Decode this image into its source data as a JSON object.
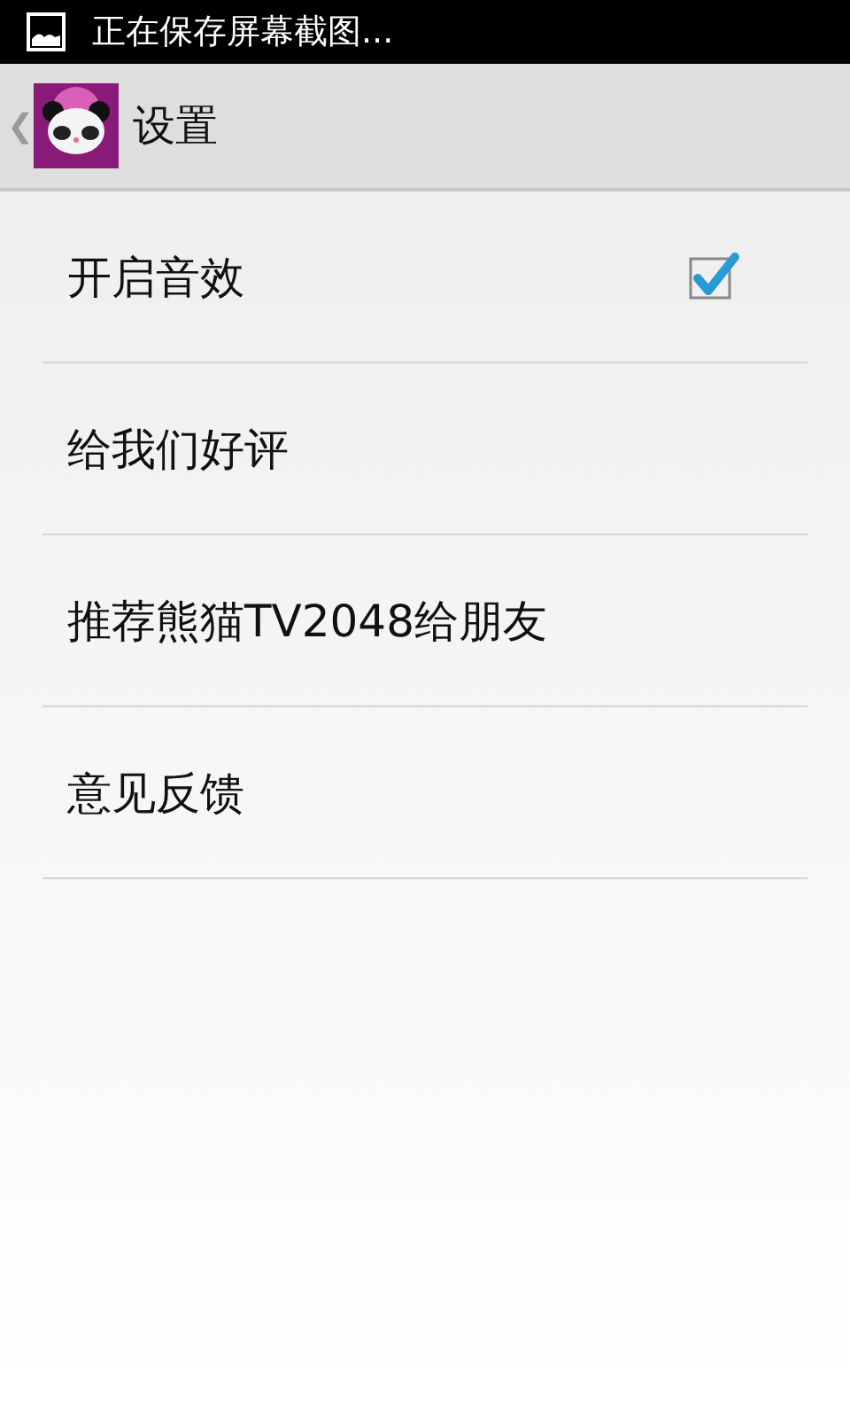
{
  "status_bar": {
    "notification": "正在保存屏幕截图..."
  },
  "action_bar": {
    "back": "❮",
    "title": "设置"
  },
  "items": [
    {
      "kind": "checkbox",
      "label": "开启音效",
      "checked": true
    },
    {
      "kind": "plain",
      "label": "给我们好评"
    },
    {
      "kind": "plain",
      "label": "推荐熊猫TV2048给朋友"
    },
    {
      "kind": "plain",
      "label": "意见反馈"
    }
  ]
}
